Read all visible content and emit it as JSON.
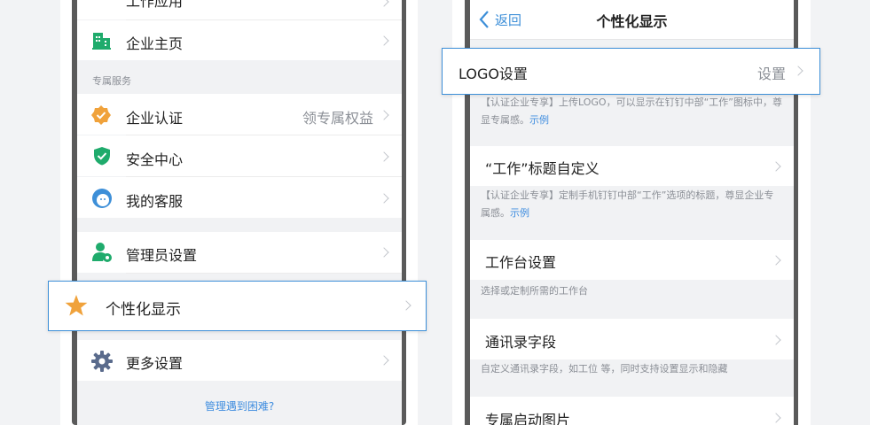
{
  "left_phone": {
    "partial_item_label": "工作应用",
    "enterprise_home_label": "企业主页",
    "section_title": "专属服务",
    "items": [
      {
        "label": "企业认证",
        "value": "领专属权益"
      },
      {
        "label": "安全中心",
        "value": ""
      },
      {
        "label": "我的客服",
        "value": ""
      }
    ],
    "admin_settings_label": "管理员设置",
    "more_settings_label": "更多设置",
    "help_link": "管理遇到困难?"
  },
  "highlight_left": {
    "label": "个性化显示",
    "icon": "star-icon"
  },
  "right_phone": {
    "back_label": "返回",
    "title": "个性化显示",
    "logo_desc_text": "【认证企业专享】上传LOGO，可以显示在钉钉中部“工作”图标中，尊显专属感。",
    "logo_desc_link": "示例",
    "work_title_label": "“工作”标题自定义",
    "work_title_desc_text": "【认证企业专享】定制手机钉钉中部“工作”选项的标题，尊显企业专属感。",
    "work_title_desc_link": "示例",
    "workbench_label": "工作台设置",
    "workbench_desc": "选择或定制所需的工作台",
    "contacts_label": "通讯录字段",
    "contacts_desc": "自定义通讯录字段，如工位 等，同时支持设置显示和隐藏",
    "splash_label": "专属启动图片"
  },
  "highlight_right": {
    "label": "LOGO设置",
    "value": "设置"
  },
  "colors": {
    "accent": "#3d8fd8",
    "orange": "#f0a23b",
    "green": "#1fab6c",
    "link": "#3f8ddf"
  }
}
